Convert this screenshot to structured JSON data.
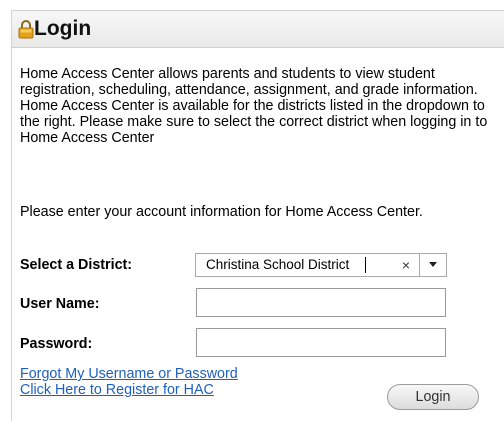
{
  "header": {
    "title": "Login",
    "icon": "lock-icon"
  },
  "intro": {
    "text": "Home Access Center allows parents and students to view student registration, scheduling, attendance, assignment, and grade information. Home Access Center is available for the districts listed in the dropdown to the right. Please make sure to select the correct district when logging in to Home Access Center"
  },
  "prompt": {
    "text": "Please enter your account information for Home Access Center."
  },
  "form": {
    "district_label": "Select a District:",
    "district_value": "Christina School District",
    "username_label": "User Name:",
    "username_value": "",
    "password_label": "Password:",
    "password_value": ""
  },
  "links": {
    "forgot": "Forgot My Username or Password",
    "register": "Click Here to Register for HAC"
  },
  "buttons": {
    "login": "Login"
  },
  "colors": {
    "link": "#1f5fbf",
    "lock": "#e3a21a"
  }
}
